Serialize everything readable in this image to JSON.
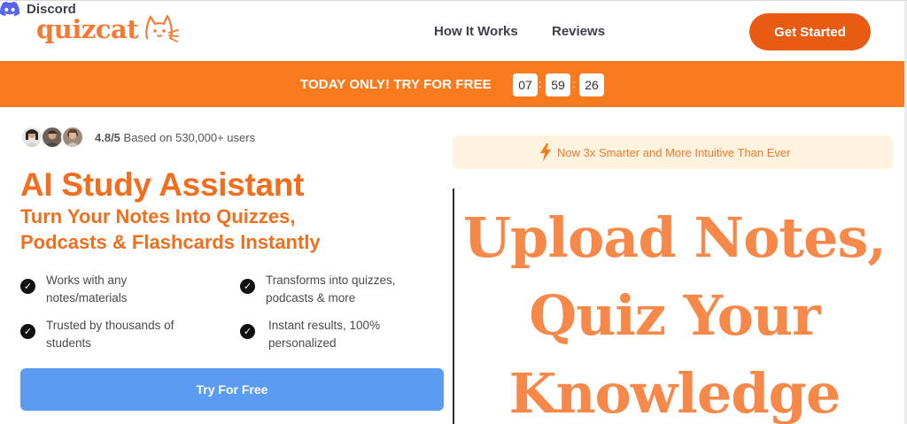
{
  "header": {
    "logo_text": "quizcat",
    "nav": {
      "how_it_works": "How It Works",
      "reviews": "Reviews",
      "discord": "Discord"
    },
    "cta_label": "Get Started"
  },
  "banner": {
    "text": "TODAY ONLY! TRY FOR FREE",
    "timer": {
      "hours": "07",
      "minutes": "59",
      "seconds": "26",
      "separator": ":"
    }
  },
  "hero": {
    "rating_score": "4.8/5",
    "rating_text": "Based on 530,000+ users",
    "title": "AI Study Assistant",
    "subtitle_line1": "Turn Your Notes Into Quizzes,",
    "subtitle_line2": "Podcasts & Flashcards Instantly",
    "features": [
      {
        "line1": "Works with any",
        "line2": "notes/materials"
      },
      {
        "line1": "Transforms into quizzes,",
        "line2": "podcasts & more"
      },
      {
        "line1": "Trusted by thousands of",
        "line2": "students"
      },
      {
        "line1": "Instant results, 100%",
        "line2": "personalized"
      }
    ],
    "try_button": "Try For Free"
  },
  "right_panel": {
    "pill_text": "Now 3x Smarter and More Intuitive Than Ever",
    "preview_lines": [
      "Upload Notes,",
      "Quiz Your",
      "Knowledge"
    ]
  },
  "colors": {
    "brand_orange": "#e85b12",
    "banner_orange": "#fa7b1e",
    "heading_orange": "#f26d1d",
    "cta_blue": "#5b9cf2",
    "pill_bg": "#fff2df"
  },
  "icons": {
    "logo": "cat-face-icon",
    "discord": "discord-icon",
    "feature": "check-circle-icon",
    "pill": "lightning-bolt-icon"
  }
}
